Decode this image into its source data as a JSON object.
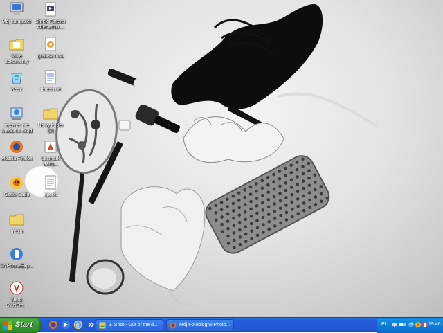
{
  "desktop": {
    "icons": [
      {
        "id": "my-computer",
        "label": "Mój komputer",
        "icon": "computer-icon"
      },
      {
        "id": "shrek",
        "label": "Shrek Forever\nAfter.2010....",
        "icon": "video-file-icon"
      },
      {
        "id": "my-documents",
        "label": "Moje\ndokumenty",
        "icon": "folder-documents-icon"
      },
      {
        "id": "grabisz",
        "label": "grabisz.m3u",
        "icon": "playlist-file-icon"
      },
      {
        "id": "recycle-bin",
        "label": "Kosz",
        "icon": "recycle-bin-icon"
      },
      {
        "id": "tbrash",
        "label": "tbrash.txt",
        "icon": "text-file-icon"
      },
      {
        "id": "ie",
        "label": "internet nie\nwiadomo skąd",
        "icon": "internet-icon"
      },
      {
        "id": "new-folder",
        "label": "Nowy folder\n(2)",
        "icon": "folder-icon"
      },
      {
        "id": "firefox",
        "label": "Mozilla Firefox",
        "icon": "firefox-icon"
      },
      {
        "id": "lexmark",
        "label": "Lexmark S301...",
        "icon": "printer-app-icon"
      },
      {
        "id": "gadu",
        "label": "Gadu-Gadu",
        "icon": "sunflower-icon"
      },
      {
        "id": "eja",
        "label": "eja.txt",
        "icon": "text-file-icon"
      },
      {
        "id": "muza",
        "label": "muza",
        "icon": "folder-icon"
      },
      {
        "id": "myphone",
        "label": "MyPhoneExp...",
        "icon": "phone-sync-icon"
      },
      {
        "id": "nero",
        "label": "Nero\nStartSm...",
        "icon": "nero-icon"
      }
    ]
  },
  "taskbar": {
    "start_label": "Start",
    "quick_launch": [
      "firefox-icon",
      "media-icon",
      "ie-icon",
      "chevron-icon"
    ],
    "tasks": [
      {
        "label": "2. Shot - Out of the d...",
        "icon": "image-app-icon",
        "active": false
      },
      {
        "label": "Mój Fotoblog w Photo...",
        "icon": "firefox-icon",
        "active": false
      }
    ],
    "tray": {
      "language": "PL",
      "icons": [
        "monitor-icon",
        "network-icon",
        "sync-icon",
        "gadu-status-icon",
        "security-icon"
      ],
      "clock": "19:46"
    }
  }
}
